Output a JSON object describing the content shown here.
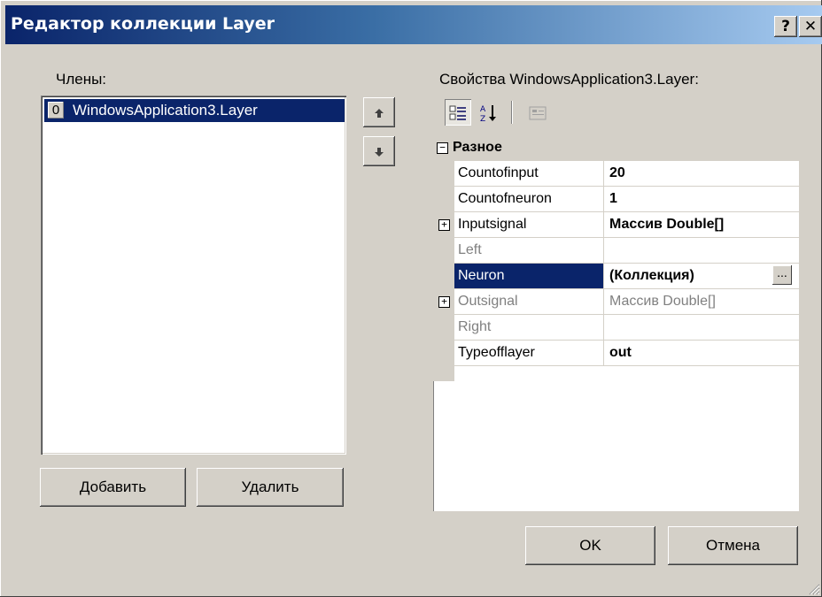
{
  "window": {
    "title": "Редактор коллекции Layer",
    "help_label": "?",
    "close_label": "✕"
  },
  "members": {
    "label": "Члены:",
    "items": [
      {
        "index": "0",
        "name": "WindowsApplication3.Layer"
      }
    ],
    "add_label": "Добавить",
    "remove_label": "Удалить",
    "up_icon": "arrow-up-icon",
    "down_icon": "arrow-down-icon"
  },
  "properties": {
    "label": "Свойства WindowsApplication3.Layer:",
    "toolbar": [
      "categorized-icon",
      "alphabetical-icon",
      "property-pages-icon"
    ],
    "category": "Разное",
    "rows": [
      {
        "name": "Countofinput",
        "value": "20",
        "bold": true,
        "grey": false,
        "expander": ""
      },
      {
        "name": "Countofneuron",
        "value": "1",
        "bold": true,
        "grey": false,
        "expander": ""
      },
      {
        "name": "Inputsignal",
        "value": "Массив Double[]",
        "bold": true,
        "grey": false,
        "expander": "+"
      },
      {
        "name": "Left",
        "value": "",
        "bold": false,
        "grey": true,
        "expander": ""
      },
      {
        "name": "Neuron",
        "value": "(Коллекция)",
        "bold": true,
        "grey": false,
        "expander": "",
        "selected": true,
        "ellipsis": "..."
      },
      {
        "name": "Outsignal",
        "value": "Массив Double[]",
        "bold": false,
        "grey": true,
        "expander": "+"
      },
      {
        "name": "Right",
        "value": "",
        "bold": false,
        "grey": true,
        "expander": ""
      },
      {
        "name": "Typeofflayer",
        "value": "out",
        "bold": true,
        "grey": false,
        "expander": ""
      }
    ]
  },
  "buttons": {
    "ok_label": "OK",
    "cancel_label": "Отмена"
  },
  "colors": {
    "face": "#d4d0c8",
    "selection": "#0a246a"
  }
}
